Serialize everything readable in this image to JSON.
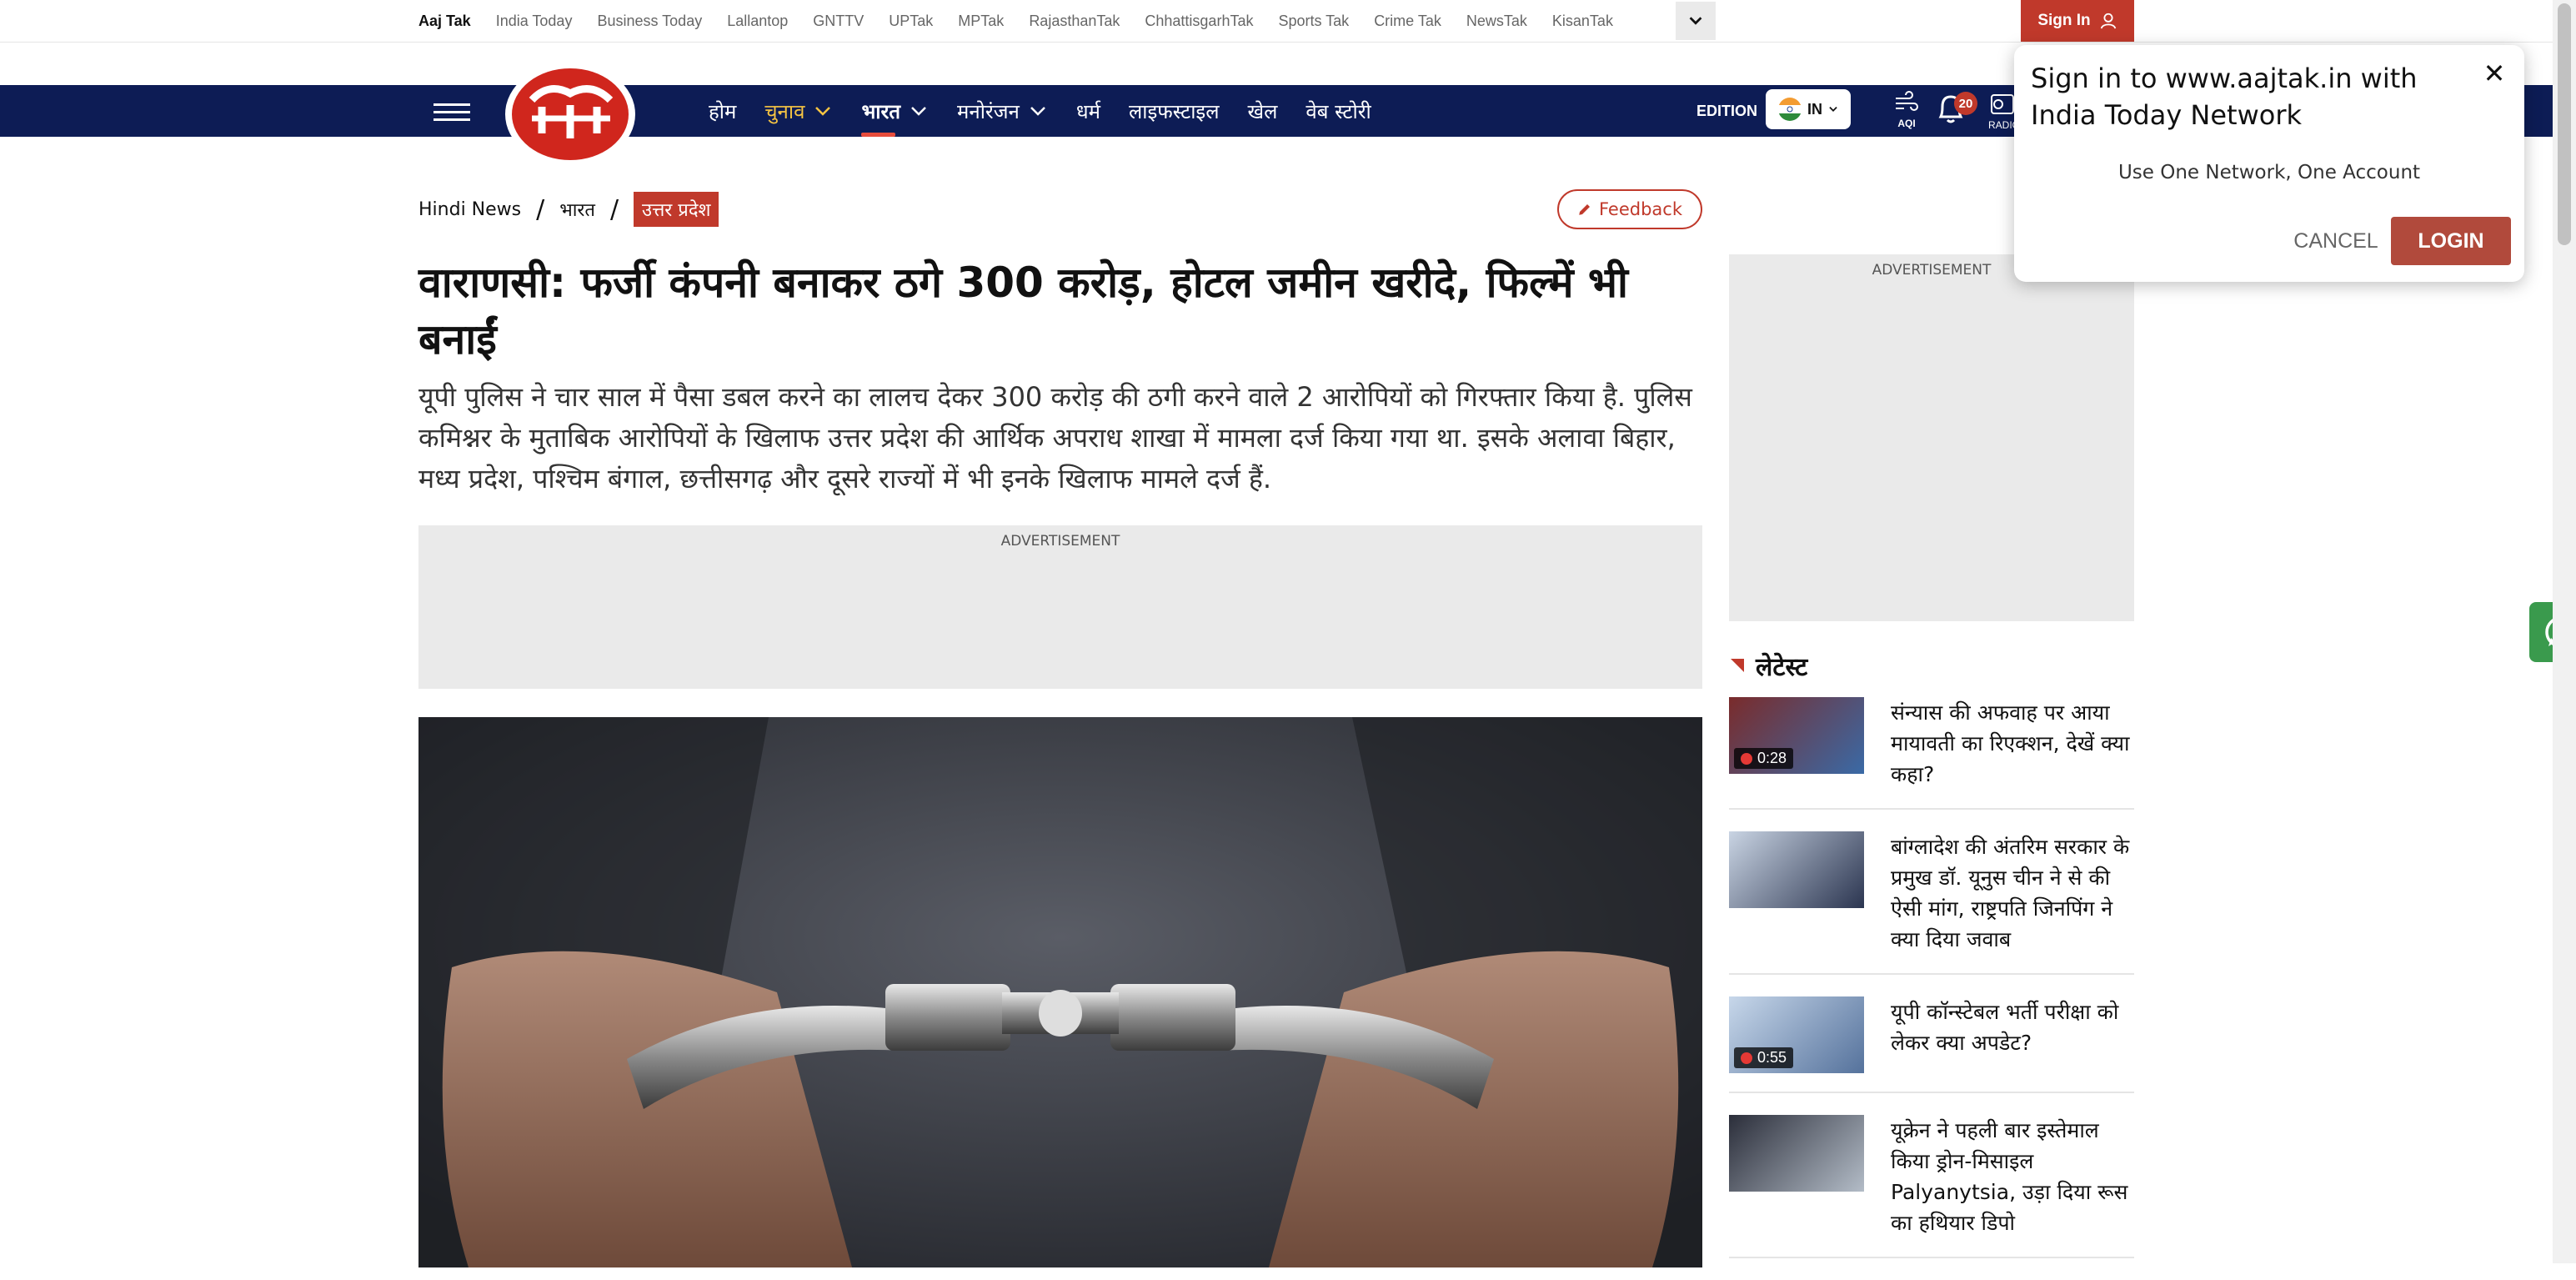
{
  "network": {
    "links": [
      "Aaj Tak",
      "India Today",
      "Business Today",
      "Lallantop",
      "GNTTV",
      "UPTak",
      "MPTak",
      "RajasthanTak",
      "ChhattisgarhTak",
      "Sports Tak",
      "Crime Tak",
      "NewsTak",
      "KisanTak"
    ],
    "active": "Aaj Tak",
    "sign_in_label": "Sign In"
  },
  "nav": {
    "items": [
      {
        "label": "होम",
        "dropdown": false
      },
      {
        "label": "चुनाव",
        "dropdown": true
      },
      {
        "label": "भारत",
        "dropdown": true
      },
      {
        "label": "मनोरंजन",
        "dropdown": true
      },
      {
        "label": "धर्म",
        "dropdown": false
      },
      {
        "label": "लाइफस्टाइल",
        "dropdown": false
      },
      {
        "label": "खेल",
        "dropdown": false
      },
      {
        "label": "वेब स्टोरी",
        "dropdown": false
      }
    ],
    "edition_label": "EDITION",
    "edition_value": "IN",
    "aqi_label": "AQI",
    "notification_count": "20",
    "radio_label": "RADIO",
    "colors": {
      "bar": "#0d1c55",
      "accent": "#c0392b",
      "highlight": "#f6c443"
    }
  },
  "breadcrumb": {
    "home": "Hindi News",
    "section": "भारत",
    "current": "उत्तर प्रदेश"
  },
  "feedback_label": "Feedback",
  "article": {
    "headline": "वाराणसी: फर्जी कंपनी बनाकर ठगे 300 करोड़, होटल जमीन खरीदे, फिल्में भी बनाईं",
    "summary": "यूपी पुलिस ने चार साल में पैसा डबल करने का लालच देकर 300 करोड़ की ठगी करने वाले 2 आरोपियों को गिरफ्तार किया है. पुलिस कमिश्नर के मुताबिक आरोपियों के खिलाफ उत्तर प्रदेश की आर्थिक अपराध शाखा में मामला दर्ज किया गया था. इसके अलावा बिहार, मध्य प्रदेश, पश्चिम बंगाल, छत्तीसगढ़ और दूसरे राज्यों में भी इनके खिलाफ मामले दर्ज हैं.",
    "image_subject": "handcuffs-photo"
  },
  "ads": {
    "main_label": "ADVERTISEMENT",
    "side_label": "ADVERTISEMENT"
  },
  "latest": {
    "heading": "लेटेस्ट",
    "items": [
      {
        "title": "संन्यास की अफवाह पर आया मायावती का रिएक्शन, देखें क्या कहा?",
        "duration": "0:28"
      },
      {
        "title": "बांग्लादेश की अंतरिम सरकार के प्रमुख डॉ. यूनुस चीन ने से की ऐसी मांग, राष्ट्रपति जिनपिंग ने क्या दिया जवाब",
        "duration": ""
      },
      {
        "title": "यूपी कॉन्स्टेबल भर्ती परीक्षा को लेकर क्या अपडेट?",
        "duration": "0:55"
      },
      {
        "title": "यूक्रेन ने पहली बार इस्तेमाल किया ड्रोन-मिसाइल Palyanytsia, उड़ा दिया रूस का हथियार डिपो",
        "duration": ""
      }
    ]
  },
  "popup": {
    "title": "Sign in to www.aajtak.in with India Today Network",
    "subtitle": "Use One Network, One Account",
    "cancel_label": "CANCEL",
    "login_label": "LOGIN"
  }
}
